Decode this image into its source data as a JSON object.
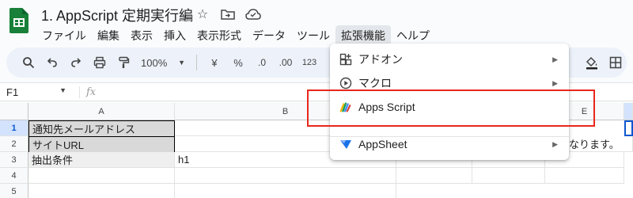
{
  "title": "1. AppScript 定期実行編",
  "menu": [
    "ファイル",
    "編集",
    "表示",
    "挿入",
    "表示形式",
    "データ",
    "ツール",
    "拡張機能",
    "ヘルプ"
  ],
  "menu_active_index": 7,
  "toolbar": {
    "zoom": "100%",
    "currency": "¥",
    "percent": "%",
    "dec_decrease": ".0",
    "dec_increase": ".00",
    "number_format": "123"
  },
  "formula_bar": {
    "name_box": "F1",
    "fx_label": "fx"
  },
  "columns": [
    "A",
    "B",
    "E"
  ],
  "rows": [
    "1",
    "2",
    "3",
    "4",
    "5"
  ],
  "cells": {
    "a1": "通知先メールアドレス",
    "a2": "サイトURL",
    "a3": "抽出条件",
    "b3": "h1",
    "overflow_row2": "なります。"
  },
  "dropdown": {
    "items": [
      {
        "label": "アドオン",
        "icon": "addon-icon",
        "has_submenu": true
      },
      {
        "label": "マクロ",
        "icon": "macro-play-icon",
        "has_submenu": true
      },
      {
        "label": "Apps Script",
        "icon": "apps-script-icon",
        "has_submenu": false
      },
      {
        "label": "AppSheet",
        "icon": "appsheet-icon",
        "has_submenu": true
      }
    ]
  },
  "colors": {
    "highlight": "#e8271b",
    "sheets_green": "#188038",
    "selected_row": "#d3e3fd"
  }
}
